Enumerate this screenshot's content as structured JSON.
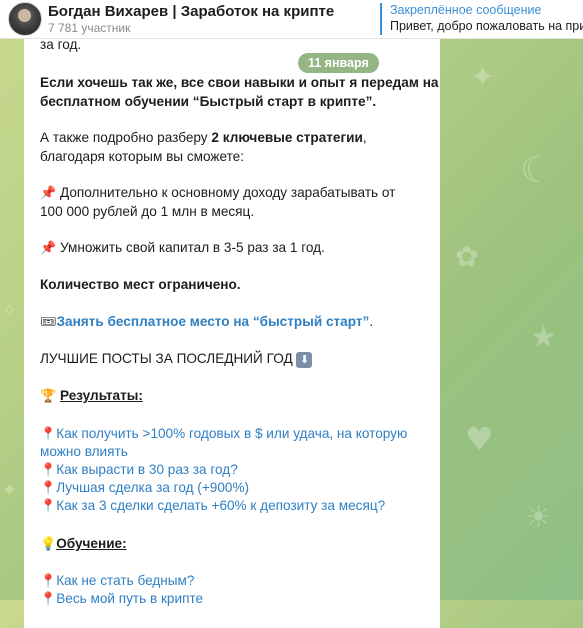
{
  "header": {
    "title": "Богдан Вихарев | Заработок на крипте",
    "members": "7 781 участник",
    "pinned_label": "Закреплённое сообщение",
    "pinned_text": "Привет, добро пожаловать на при"
  },
  "date_chip": "11 января",
  "message": {
    "top_fragment": "за год.",
    "p1_l1": "Если хочешь так же, все свои навыки и опыт я передам на",
    "p1_l2": "бесплатном обучении “Быстрый старт в крипте”.",
    "p2_l1_a": "А также подробно разберу ",
    "p2_l1_b": "2 ключевые стратегии",
    "p2_l1_c": ",",
    "p2_l2": "благодаря которым вы сможете:",
    "pin_emoji": "📌",
    "p3_l1": " Дополнительно к основному доходу зарабатывать от",
    "p3_l2": "100 000 рублей до 1 млн в месяц.",
    "p4": " Умножить свой капитал в 3-5 раз за 1 год.",
    "p5": "Количество мест ограничено.",
    "ticket_emoji": "🎟",
    "cta_link": "Занять бесплатное место на “быстрый старт”",
    "cta_dot": ".",
    "best_posts": "ЛУЧШИЕ ПОСТЫ ЗА ПОСЛЕДНИЙ ГОД",
    "down_emoji": "⬇",
    "trophy_emoji": "🏆",
    "results_heading": "Результаты:",
    "pushpin_emoji": "📍",
    "results": [
      "Как получить >100% годовых в $ или удача, на которую",
      "можно влиять",
      "Как вырасти в 30 раз за год?",
      "Лучшая сделка за год (+900%)",
      "Как за 3 сделки сделать +60% к депозиту за месяц?"
    ],
    "bulb_emoji": "💡",
    "education_heading": "Обучение:",
    "education": [
      "Как не стать бедным?",
      "Весь мой путь в крипте"
    ]
  }
}
